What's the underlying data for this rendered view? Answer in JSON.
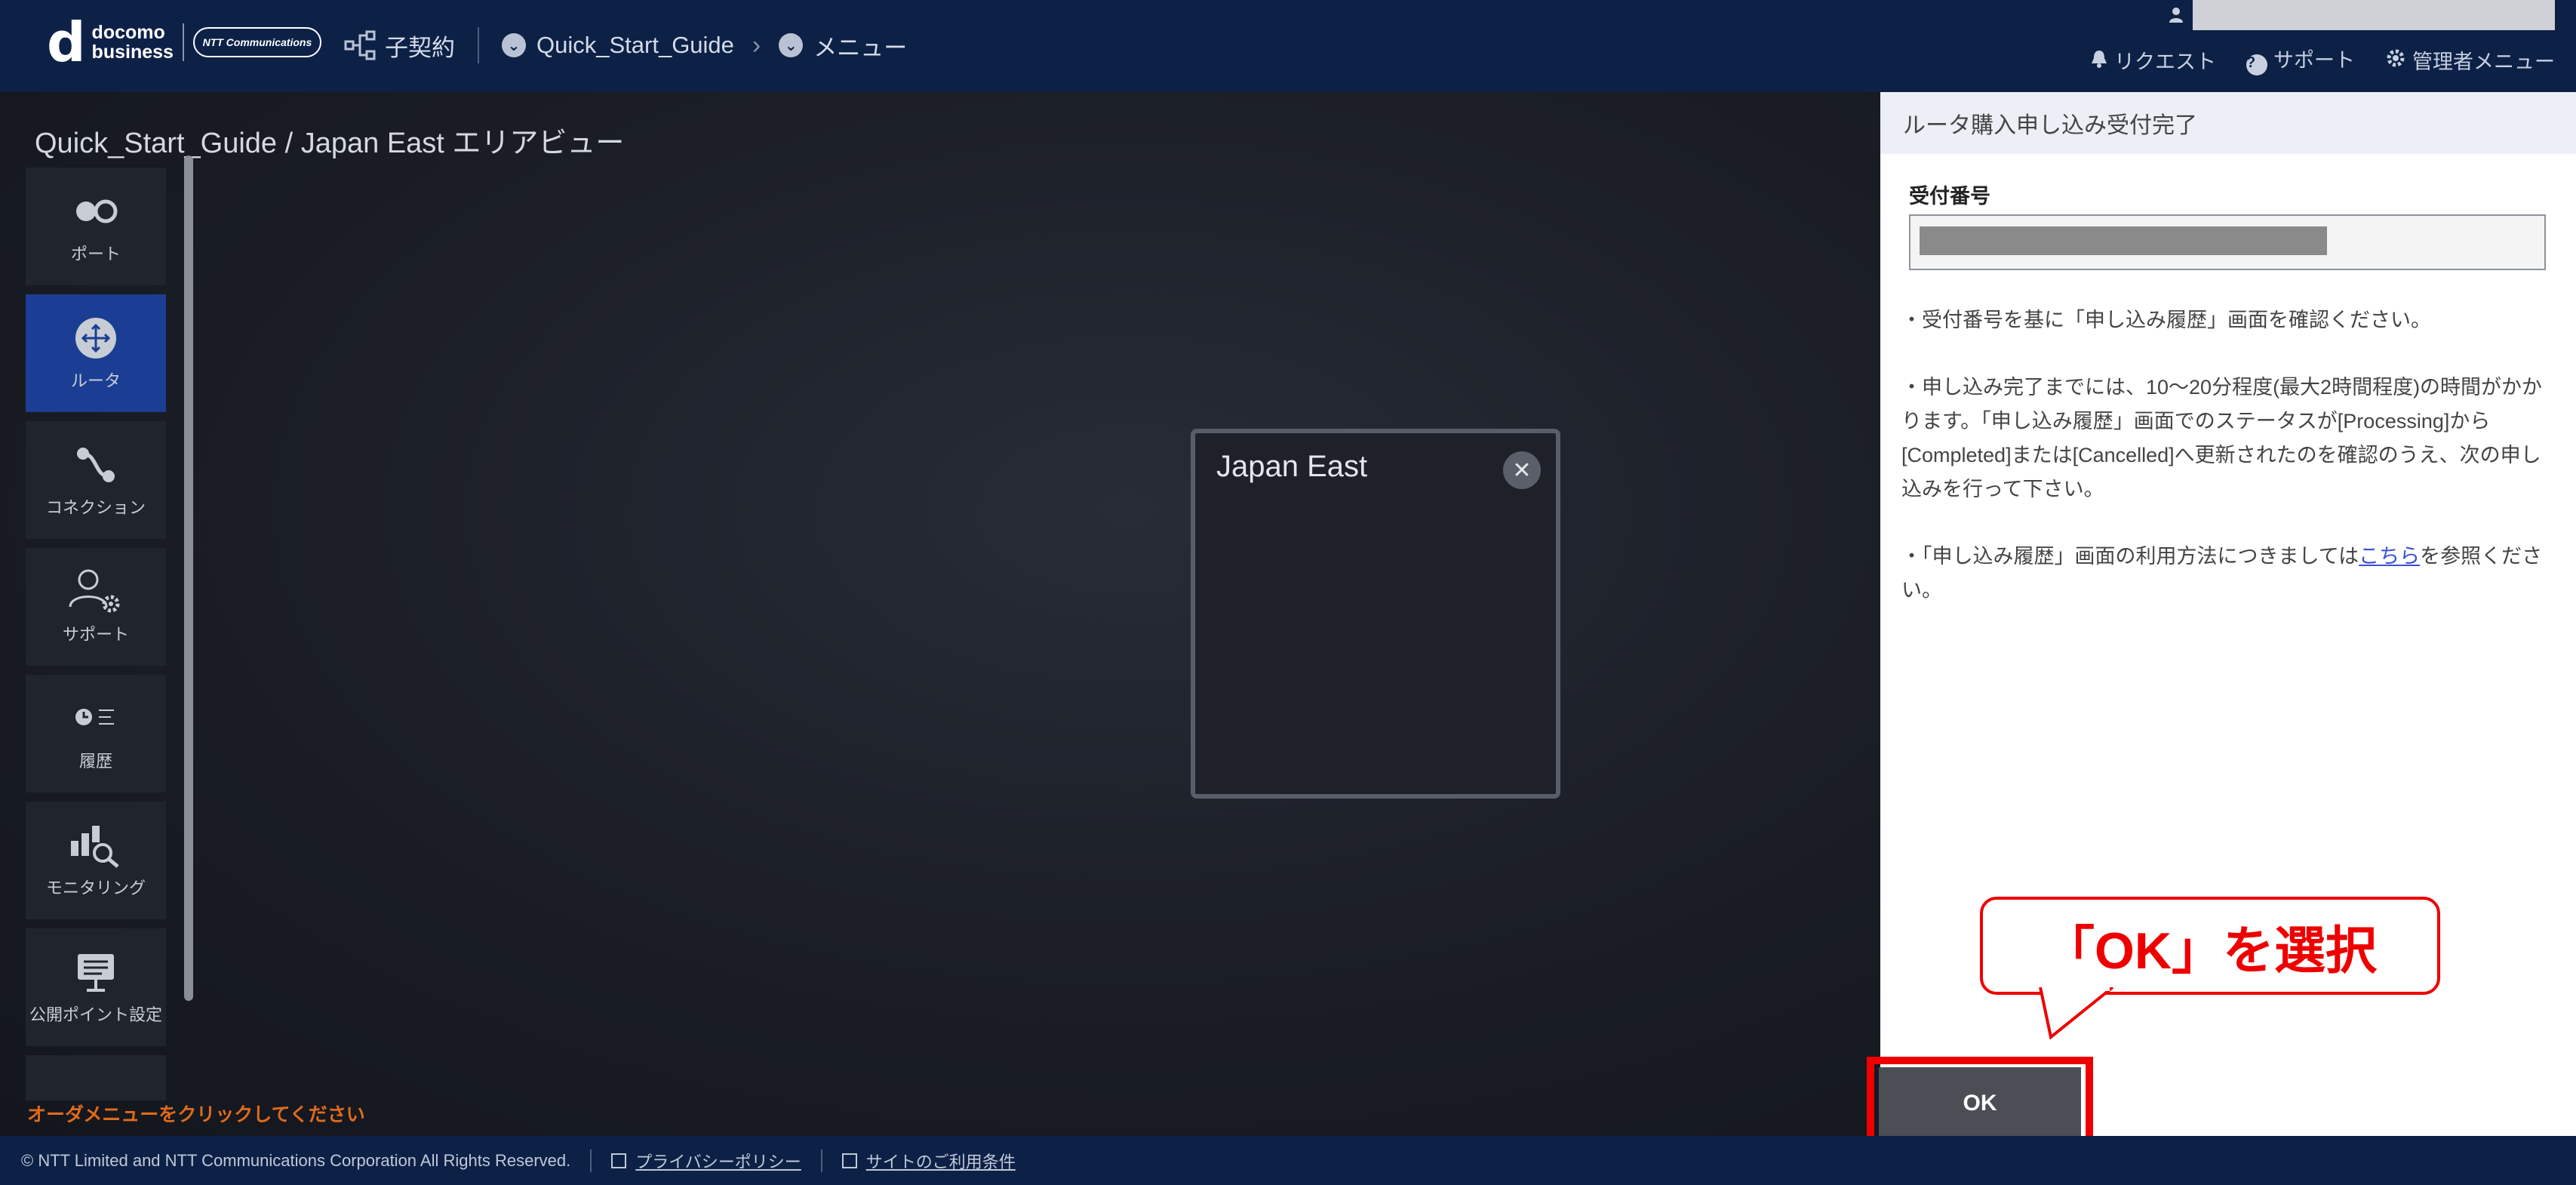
{
  "header": {
    "brand_top": "docomo",
    "brand_bottom": "business",
    "ntt_logo": "NTT Communications",
    "nav": {
      "contract": "子契約",
      "project": "Quick_Start_Guide",
      "menu": "メニュー"
    },
    "links": {
      "request": "リクエスト",
      "support": "サポート",
      "admin": "管理者メニュー"
    }
  },
  "main": {
    "page_title": "Quick_Start_Guide / Japan East エリアビュー",
    "sidebar": [
      {
        "label": "ポート",
        "icon": "port-icon"
      },
      {
        "label": "ルータ",
        "icon": "router-icon",
        "active": true
      },
      {
        "label": "コネクション",
        "icon": "connection-icon"
      },
      {
        "label": "サポート",
        "icon": "support-user-icon"
      },
      {
        "label": "履歴",
        "icon": "history-icon"
      },
      {
        "label": "モニタリング",
        "icon": "monitoring-icon"
      },
      {
        "label": "公開ポイント設定",
        "icon": "public-point-icon"
      }
    ],
    "order_hint": "オーダメニューをクリックしてください",
    "area_box": {
      "title": "Japan East"
    }
  },
  "panel": {
    "title": "ルータ購入申し込み受付完了",
    "field_label": "受付番号",
    "para1": "・受付番号を基に「申し込み履歴」画面を確認ください。",
    "para2": "・申し込み完了までには、10～20分程度(最大2時間程度)の時間がかかります。「申し込み履歴」画面でのステータスが[Processing]から[Completed]または[Cancelled]へ更新されたのを確認のうえ、次の申し込みを行って下さい。",
    "para3_before": "・「申し込み履歴」画面の利用方法につきましては",
    "para3_link": "こちら",
    "para3_after": "を参照ください。",
    "ok_label": "OK"
  },
  "annotation": {
    "callout": "「OK」を選択",
    "color": "#ee0000"
  },
  "footer": {
    "copyright": "© NTT Limited and NTT Communications Corporation All Rights Reserved.",
    "privacy": "プライバシーポリシー",
    "terms": "サイトのご利用条件"
  },
  "colors": {
    "header_bg": "#0d2147",
    "active_sidebar": "#1b3e94",
    "hint": "#e06a1a"
  }
}
